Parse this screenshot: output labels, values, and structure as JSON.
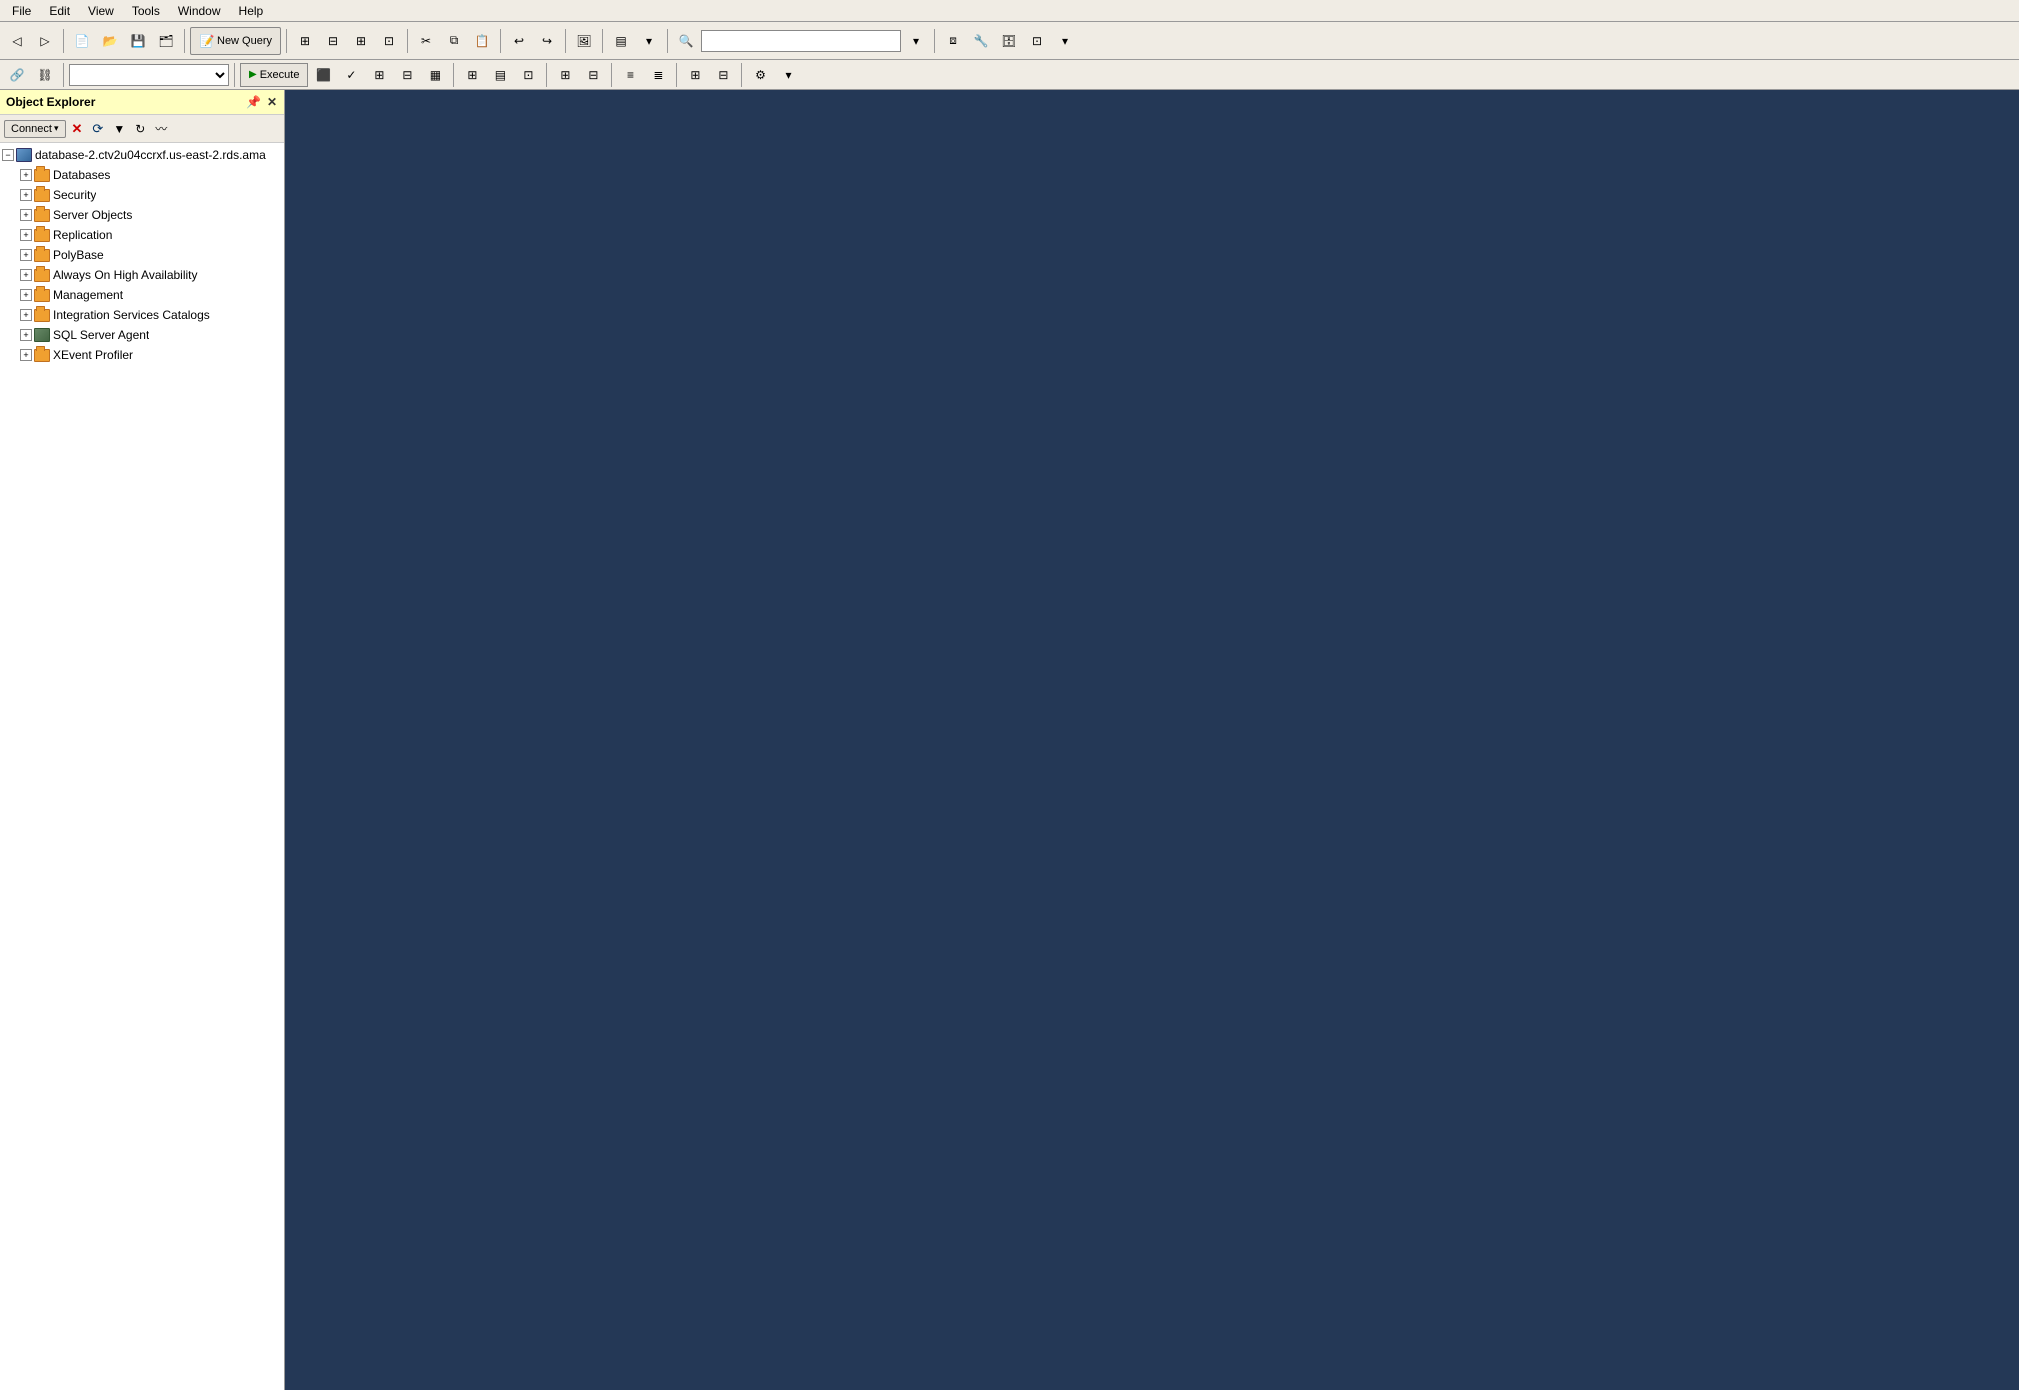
{
  "menubar": {
    "items": [
      "File",
      "Edit",
      "View",
      "Tools",
      "Window",
      "Help"
    ]
  },
  "toolbar": {
    "new_query_label": "New Query",
    "search_placeholder": ""
  },
  "toolbar2": {
    "execute_label": "Execute",
    "dropdown_value": ""
  },
  "object_explorer": {
    "title": "Object Explorer",
    "connect_label": "Connect",
    "server_node": "database-2.ctv2u04ccrxf.us-east-2.rds.ama",
    "tree_items": [
      {
        "label": "Databases",
        "type": "folder",
        "level": 1
      },
      {
        "label": "Security",
        "type": "folder",
        "level": 1
      },
      {
        "label": "Server Objects",
        "type": "folder",
        "level": 1
      },
      {
        "label": "Replication",
        "type": "folder",
        "level": 1
      },
      {
        "label": "PolyBase",
        "type": "folder",
        "level": 1
      },
      {
        "label": "Always On High Availability",
        "type": "folder",
        "level": 1
      },
      {
        "label": "Management",
        "type": "folder",
        "level": 1
      },
      {
        "label": "Integration Services Catalogs",
        "type": "folder",
        "level": 1
      },
      {
        "label": "SQL Server Agent",
        "type": "agent",
        "level": 1
      },
      {
        "label": "XEvent Profiler",
        "type": "folder",
        "level": 1
      }
    ]
  }
}
